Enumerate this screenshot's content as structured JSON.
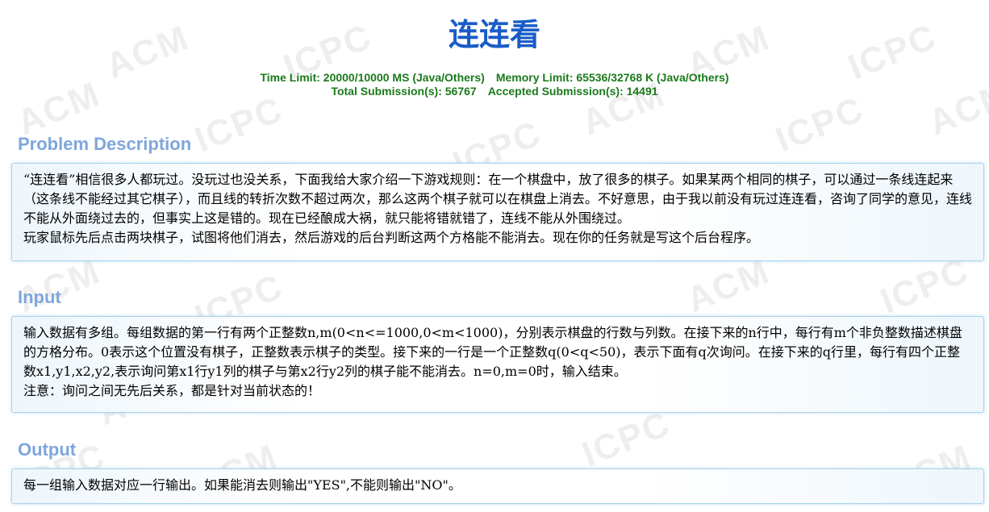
{
  "title": "连连看",
  "limits": {
    "time_limit": "Time Limit: 20000/10000 MS (Java/Others)",
    "memory_limit": "Memory Limit: 65536/32768 K (Java/Others)",
    "total_submissions": "Total Submission(s): 56767",
    "accepted_submissions": "Accepted Submission(s): 14491"
  },
  "watermark_text": "ACM ICPC",
  "sections": {
    "description": {
      "heading": "Problem Description",
      "paragraphs": [
        "“连连看”相信很多人都玩过。没玩过也没关系，下面我给大家介绍一下游戏规则：在一个棋盘中，放了很多的棋子。如果某两个相同的棋子，可以通过一条线连起来（这条线不能经过其它棋子），而且线的转折次数不超过两次，那么这两个棋子就可以在棋盘上消去。不好意思，由于我以前没有玩过连连看，咨询了同学的意见，连线不能从外面绕过去的，但事实上这是错的。现在已经酿成大祸，就只能将错就错了，连线不能从外围绕过。",
        "玩家鼠标先后点击两块棋子，试图将他们消去，然后游戏的后台判断这两个方格能不能消去。现在你的任务就是写这个后台程序。"
      ]
    },
    "input": {
      "heading": "Input",
      "paragraphs": [
        "输入数据有多组。每组数据的第一行有两个正整数n,m(0<n<=1000,0<m<1000)，分别表示棋盘的行数与列数。在接下来的n行中，每行有m个非负整数描述棋盘的方格分布。0表示这个位置没有棋子，正整数表示棋子的类型。接下来的一行是一个正整数q(0<q<50)，表示下面有q次询问。在接下来的q行里，每行有四个正整数x1,y1,x2,y2,表示询问第x1行y1列的棋子与第x2行y2列的棋子能不能消去。n=0,m=0时，输入结束。",
        "注意：询问之间无先后关系，都是针对当前状态的！"
      ]
    },
    "output": {
      "heading": "Output",
      "paragraphs": [
        "每一组输入数据对应一行输出。如果能消去则输出\"YES\",不能则输出\"NO\"。"
      ]
    }
  },
  "colors": {
    "title": "#1a5cc8",
    "limits": "#1a7a1a",
    "section_heading": "#7ea6dc",
    "panel_border": "#a9d3ef"
  }
}
